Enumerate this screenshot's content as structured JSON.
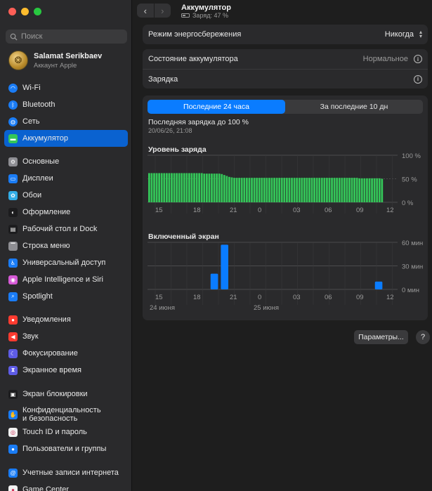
{
  "window": {
    "controls": [
      "close",
      "minimize",
      "zoom"
    ]
  },
  "sidebar": {
    "search_placeholder": "Поиск",
    "profile": {
      "name": "Salamat Serikbaev",
      "subtitle": "Аккаунт Apple"
    },
    "items": [
      {
        "label": "Wi-Fi",
        "icon": "wifi-icon",
        "color": "#1a7cf5",
        "active": false
      },
      {
        "label": "Bluetooth",
        "icon": "bluetooth-icon",
        "color": "#1a7cf5",
        "active": false
      },
      {
        "label": "Сеть",
        "icon": "globe-icon",
        "color": "#1a7cf5",
        "active": false
      },
      {
        "label": "Аккумулятор",
        "icon": "battery-icon",
        "color": "#34c759",
        "active": true
      },
      {
        "label": "Основные",
        "icon": "gear-icon",
        "color": "#8e8e93",
        "active": false
      },
      {
        "label": "Дисплеи",
        "icon": "display-icon",
        "color": "#1a7cf5",
        "active": false
      },
      {
        "label": "Обои",
        "icon": "flower-icon",
        "color": "#32ade6",
        "active": false
      },
      {
        "label": "Оформление",
        "icon": "appearance-icon",
        "color": "#1c1c1e",
        "active": false
      },
      {
        "label": "Рабочий стол и Dock",
        "icon": "dock-icon",
        "color": "#1c1c1e",
        "active": false
      },
      {
        "label": "Строка меню",
        "icon": "menubar-icon",
        "color": "#8e8e93",
        "active": false
      },
      {
        "label": "Универсальный доступ",
        "icon": "accessibility-icon",
        "color": "#1a7cf5",
        "active": false
      },
      {
        "label": "Apple Intelligence и Siri",
        "icon": "siri-icon",
        "color": "#d65ad6",
        "active": false
      },
      {
        "label": "Spotlight",
        "icon": "magnifier-icon",
        "color": "#1a7cf5",
        "active": false
      },
      {
        "label": "Уведомления",
        "icon": "bell-icon",
        "color": "#ff3b30",
        "active": false
      },
      {
        "label": "Звук",
        "icon": "speaker-icon",
        "color": "#ff3b30",
        "active": false
      },
      {
        "label": "Фокусирование",
        "icon": "moon-icon",
        "color": "#5e5ce6",
        "active": false
      },
      {
        "label": "Экранное время",
        "icon": "hourglass-icon",
        "color": "#5e5ce6",
        "active": false
      },
      {
        "label": "Экран блокировки",
        "icon": "lock-screen-icon",
        "color": "#1c1c1e",
        "active": false
      },
      {
        "label": "Конфиденциальность",
        "label2": "и безопасность",
        "icon": "hand-icon",
        "color": "#1a7cf5",
        "active": false
      },
      {
        "label": "Touch ID и пароль",
        "icon": "fingerprint-icon",
        "color": "#f2f2f2",
        "active": false
      },
      {
        "label": "Пользователи и группы",
        "icon": "users-icon",
        "color": "#1a7cf5",
        "active": false
      },
      {
        "label": "Учетные записи интернета",
        "icon": "at-icon",
        "color": "#1a7cf5",
        "active": false
      },
      {
        "label": "Game Center",
        "icon": "gamecenter-icon",
        "color": "#f2f2f2",
        "active": false
      }
    ]
  },
  "header": {
    "title": "Аккумулятор",
    "subtitle": "Заряд: 47 %"
  },
  "settings": {
    "low_power_label": "Режим энергосбережения",
    "low_power_value": "Никогда",
    "health_label": "Состояние аккумулятора",
    "health_value": "Нормальное",
    "charging_label": "Зарядка"
  },
  "usage": {
    "tabs": [
      {
        "label": "Последние 24 часа",
        "selected": true
      },
      {
        "label": "За последние 10 дн",
        "selected": false
      }
    ],
    "last_charge": "Последняя зарядка до 100 %",
    "last_charge_date": "20/06/26, 21:08",
    "battery_title": "Уровень заряда",
    "screen_title": "Включенный экран"
  },
  "chart_data": [
    {
      "type": "bar",
      "title": "Уровень заряда",
      "y_unit": "%",
      "ylim": [
        0,
        100
      ],
      "yticks": [
        "100 %",
        "50 %",
        "0 %"
      ],
      "xticks": [
        "15",
        "18",
        "21",
        "0",
        "03",
        "06",
        "09",
        "12"
      ],
      "color": "#34c759",
      "grid": true,
      "values": [
        62,
        62,
        62,
        62,
        62,
        62,
        62,
        62,
        62,
        62,
        62,
        62,
        62,
        62,
        62,
        62,
        62,
        62,
        62,
        62,
        62,
        62,
        61,
        61,
        61,
        61,
        61,
        61,
        61,
        60,
        58,
        56,
        54,
        53,
        52,
        52,
        52,
        52,
        52,
        52,
        52,
        52,
        52,
        52,
        52,
        52,
        52,
        52,
        52,
        52,
        52,
        52,
        52,
        52,
        52,
        52,
        52,
        52,
        52,
        52,
        52,
        52,
        52,
        52,
        52,
        52,
        52,
        52,
        52,
        52,
        52,
        52,
        52,
        52,
        52,
        52,
        52,
        52,
        52,
        52,
        52,
        52,
        52,
        52,
        51,
        51,
        51,
        51,
        51,
        51,
        51,
        51,
        51,
        50
      ]
    },
    {
      "type": "bar",
      "title": "Включенный экран",
      "y_unit": "мин",
      "ylim": [
        0,
        60
      ],
      "yticks": [
        "60 мин",
        "30 мин",
        "0 мин"
      ],
      "xticks": [
        "15",
        "18",
        "21",
        "0",
        "03",
        "06",
        "09",
        "12"
      ],
      "day_labels": [
        "24 июня",
        "25 июня"
      ],
      "color": "#0a7cff",
      "grid": true,
      "hours": [
        "15",
        "16",
        "17",
        "18",
        "19",
        "20",
        "21",
        "22",
        "23",
        "0",
        "1",
        "2",
        "3",
        "4",
        "5",
        "6",
        "7",
        "8",
        "9",
        "10",
        "11",
        "12",
        "13",
        "14"
      ],
      "values": [
        0,
        0,
        0,
        0,
        0,
        0,
        20,
        57,
        0,
        0,
        0,
        0,
        0,
        0,
        0,
        0,
        0,
        0,
        0,
        0,
        0,
        0,
        10,
        0
      ]
    }
  ],
  "footer": {
    "options_label": "Параметры...",
    "help_label": "?"
  }
}
